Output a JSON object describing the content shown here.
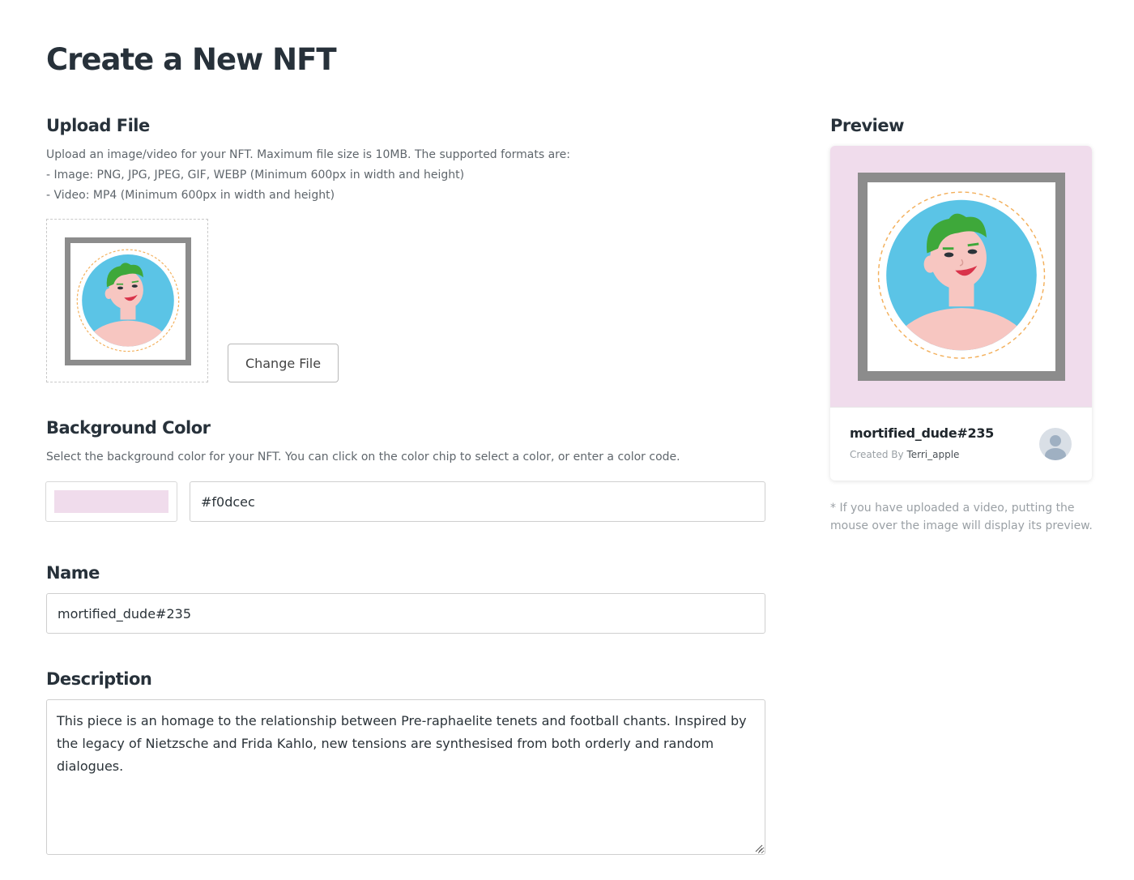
{
  "page": {
    "title": "Create a New NFT"
  },
  "upload": {
    "heading": "Upload File",
    "help_lines": [
      "Upload an image/video for your NFT. Maximum file size is 10MB. The supported formats are:",
      "- Image: PNG, JPG, JPEG, GIF, WEBP (Minimum 600px in width and height)",
      "- Video: MP4 (Minimum 600px in width and height)"
    ],
    "change_button": "Change File"
  },
  "background": {
    "heading": "Background Color",
    "help": "Select the background color for your NFT. You can click on the color chip to select a color, or enter a color code.",
    "value": "#f0dcec",
    "chip_color": "#f0dcec"
  },
  "name_field": {
    "heading": "Name",
    "value": "mortified_dude#235"
  },
  "description": {
    "heading": "Description",
    "value": "This piece is an homage to the relationship between Pre-raphaelite tenets and football chants. Inspired by the legacy of Nietzsche and Frida Kahlo, new tensions are synthesised from both orderly and random dialogues."
  },
  "preview": {
    "heading": "Preview",
    "name": "mortified_dude#235",
    "created_by_label": "Created By",
    "creator": "Terri_apple",
    "note": "* If you have uploaded a video, putting the mouse over the image will display its preview."
  },
  "colors": {
    "preview_bg": "#f0dcec",
    "frame": "#8c8c8c",
    "circle": "#5bc4e6",
    "hair": "#3ea83a",
    "skin": "#f7c6c1"
  },
  "icons": {
    "artwork": "nft-character-artwork",
    "avatar": "user-avatar-icon",
    "resize": "resize-grip-icon"
  }
}
